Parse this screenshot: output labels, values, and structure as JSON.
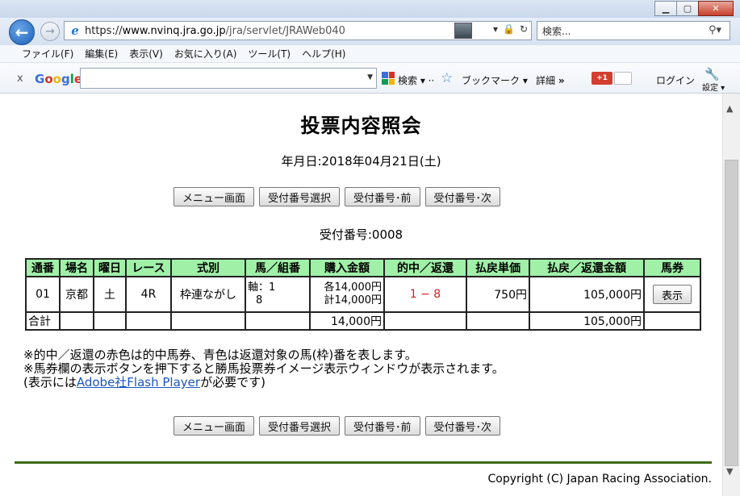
{
  "browser": {
    "address": {
      "scheme": "https://",
      "host": "www.nvinq.jra.go.jp",
      "path": "/jra/servlet/JRAWeb040"
    },
    "search_placeholder": "検索...",
    "menu": [
      "ファイル(F)",
      "編集(E)",
      "表示(V)",
      "お気に入り(A)",
      "ツール(T)",
      "ヘルプ(H)"
    ],
    "google_toolbar": {
      "close": "x",
      "logo": [
        "G",
        "o",
        "o",
        "g",
        "l",
        "e"
      ],
      "search_label": "検索",
      "bookmark_label": "ブックマーク",
      "detail_label": "詳細",
      "gplus_label": "+1",
      "login_label": "ログイン",
      "settings_label": "設定"
    }
  },
  "page": {
    "title": "投票内容照会",
    "date_line": "年月日:2018年04月21日(土)",
    "receipt_line": "受付番号:0008",
    "buttons": {
      "menu": "メニュー画面",
      "select": "受付番号選択",
      "prev": "受付番号･前",
      "next": "受付番号･次"
    },
    "table": {
      "headers": [
        "通番",
        "場名",
        "曜日",
        "レース",
        "式別",
        "馬／組番",
        "購入金額",
        "的中／返還",
        "払戻単価",
        "払戻／返還金額",
        "馬券"
      ],
      "rows": [
        {
          "no": "01",
          "venue": "京都",
          "day": "土",
          "race": "4R",
          "type": "枠連ながし",
          "combo_line1": "軸：1",
          "combo_line2": "8",
          "amount_line1": "各14,000円",
          "amount_line2": "計14,000円",
          "hit": "1 − 8",
          "unit_payout": "750円",
          "payout": "105,000円",
          "ticket_button": "表示"
        }
      ],
      "total": {
        "label": "合計",
        "amount": "14,000円",
        "payout": "105,000円"
      }
    },
    "notes": {
      "line1": "※的中／返還の赤色は的中馬券、青色は返還対象の馬(枠)番を表します。",
      "line2": "※馬券欄の表示ボタンを押下すると勝馬投票券イメージ表示ウィンドウが表示されます。",
      "line3_prefix": "(表示には",
      "line3_link": "Adobe社Flash Player",
      "line3_suffix": "が必要です)"
    },
    "copyright": "Copyright (C) Japan Racing Association."
  }
}
